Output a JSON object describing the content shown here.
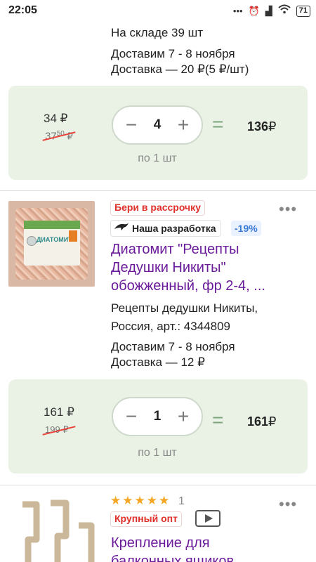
{
  "status_bar": {
    "time": "22:05",
    "icons": [
      "dots-icon",
      "alarm-icon",
      "signal-icon",
      "wifi-icon"
    ],
    "battery": "71"
  },
  "product1": {
    "stock": "На складе 39 шт",
    "delivery_date": "Доставим 7 - 8 ноября",
    "delivery_cost": "Доставка — 20 ₽(5 ₽/шт)",
    "price": {
      "current": "34",
      "old_main": "37",
      "old_cents": "50",
      "currency": "₽",
      "quantity": "4",
      "step_note": "по 1 шт",
      "equals": "=",
      "total": "136",
      "minus": "−",
      "plus": "+"
    }
  },
  "product2": {
    "badge_installment": "Бери в рассрочку",
    "badge_dev": "Наша разработка",
    "discount": "-19%",
    "title_line1": "Диатомит \"Рецепты",
    "title_line2": "Дедушки Никиты\"",
    "title_line3": "обожженный, фр 2-4, ...",
    "seller_line1": "Рецепты дедушки Никиты,",
    "seller_line2": "Россия, арт.: 4344809",
    "delivery_date": "Доставим 7 - 8 ноября",
    "delivery_cost": "Доставка — 12 ₽",
    "image_label": "ДИАТОМИТ",
    "price": {
      "current": "161",
      "old": "199",
      "currency": "₽",
      "quantity": "1",
      "step_note": "по 1 шт",
      "equals": "=",
      "total": "161",
      "minus": "−",
      "plus": "+"
    }
  },
  "product3": {
    "stars": "★★★★★",
    "rating": 5,
    "rating_count": "1",
    "badge_wholesale": "Крупный опт",
    "title_line1": "Крепление для",
    "title_line2": "балконных ящиков"
  },
  "more_menu": "•••",
  "colors": {
    "accent_purple": "#6a1b9a",
    "card_green": "#eaf2e6",
    "badge_red": "#e0302a",
    "discount_blue": "#3a7bd5",
    "star": "#f5a623"
  }
}
